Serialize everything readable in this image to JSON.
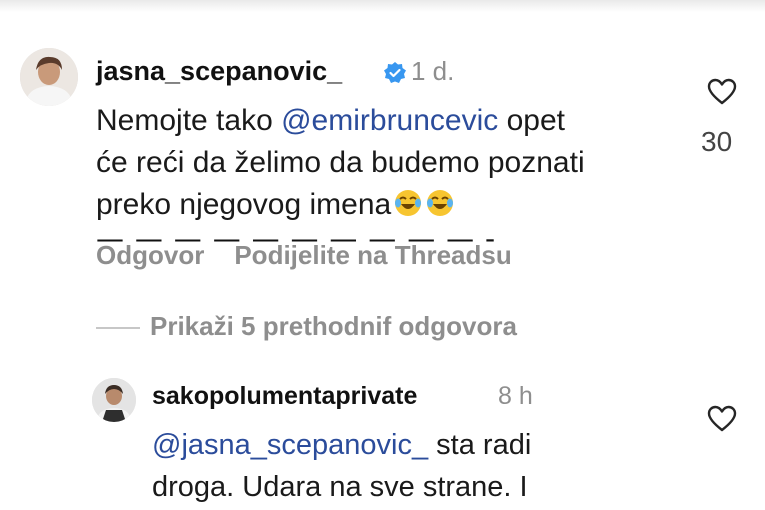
{
  "comments": [
    {
      "username": "jasna_scepanovic_",
      "verified": true,
      "time": "1 d.",
      "text_line1_a": "Nemojte tako ",
      "mention1": "@emirbruncevic",
      "text_line1_b": " opet",
      "text_line2": "će reći da želimo da budemo poznati",
      "text_line3": "preko njegovog imena",
      "emoji": [
        "joy-emoji",
        "joy-emoji"
      ],
      "dashes": "— — — — — — — — — — -",
      "reply_label": "Odgovor",
      "share_label": "Podijelite na Threadsu",
      "like_count": "30"
    },
    {
      "username": "sakopolumentaprivate",
      "time": "8 h",
      "mention": "@jasna_scepanovic_",
      "text_line1_b": " sta radi",
      "text_line2": "droga. Udara na sve strane. I"
    }
  ],
  "show_previous_replies": "Prikaži 5 prethodnif odgovora",
  "colors": {
    "mention": "#2b4c9b",
    "muted": "#8e8e8e",
    "verified": "#3897f0"
  },
  "icons": [
    "heart-icon",
    "verified-badge-icon",
    "avatar"
  ]
}
